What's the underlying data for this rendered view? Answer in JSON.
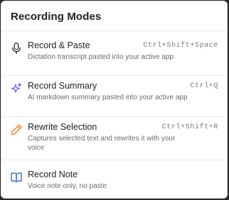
{
  "panel": {
    "title": "Recording Modes"
  },
  "modes": [
    {
      "name": "Record & Paste",
      "shortcut": "Ctrl+Shift+Space",
      "description": "Dictation transcript pasted into your active app",
      "icon": "microphone-icon"
    },
    {
      "name": "Record Summary",
      "shortcut": "Ctrl+Q",
      "description": "AI markdown summary pasted into your active app",
      "icon": "sparkle-icon"
    },
    {
      "name": "Rewrite Selection",
      "shortcut": "Ctrl+Shift+R",
      "description": "Captures selected text and rewrites it with your voice",
      "icon": "pencil-icon"
    },
    {
      "name": "Record Note",
      "shortcut": "",
      "description": "Voice note only, no paste",
      "icon": "book-icon"
    }
  ],
  "colors": {
    "sparkle": "#8b5cf6",
    "pencil": "#e8842c",
    "book": "#3b6fd8",
    "mic": "#333333"
  }
}
